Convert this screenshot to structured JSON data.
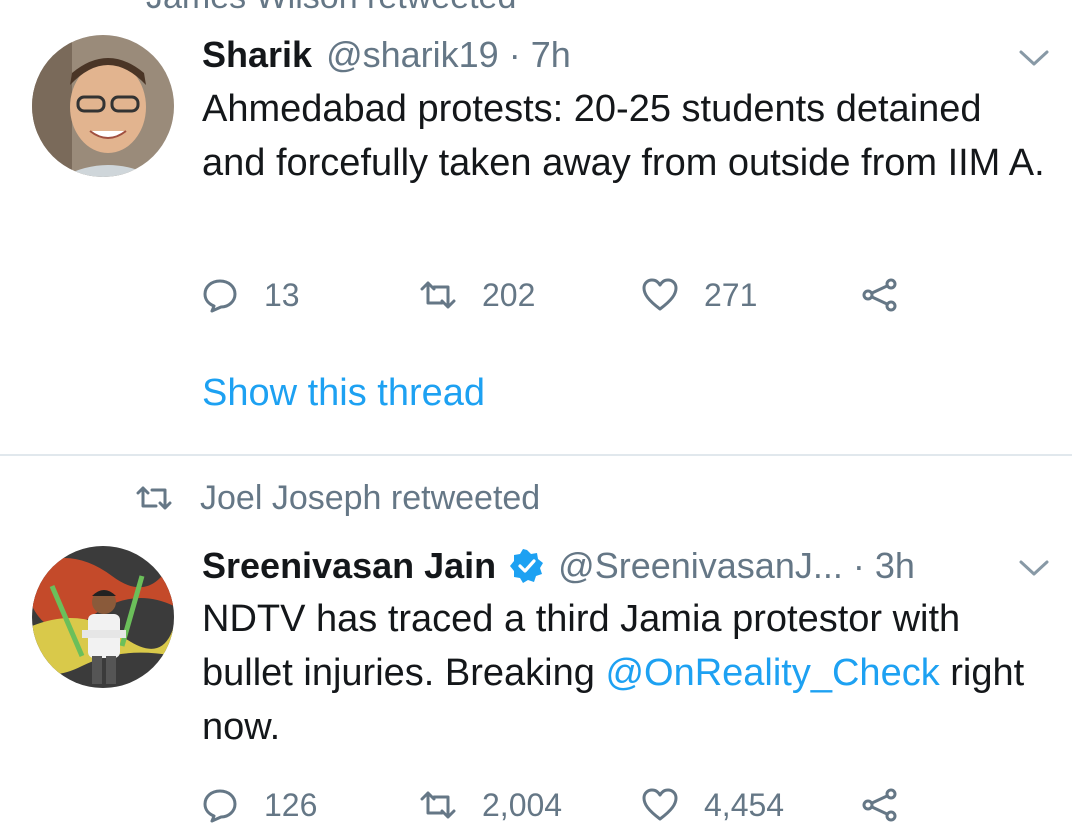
{
  "top_context": {
    "text": "James Wilson retweeted"
  },
  "tweets": [
    {
      "name": "Sharik",
      "handle": "@sharik19",
      "separator": "·",
      "time": "7h",
      "text": "Ahmedabad protests: 20-25 students detained and forcefully taken away from outside from IIM A.",
      "replies": "13",
      "retweets": "202",
      "likes": "271",
      "show_thread": "Show this thread",
      "avatar_icon": "user-avatar-sharik"
    },
    {
      "retweet_context": "Joel Joseph retweeted",
      "name": "Sreenivasan Jain",
      "verified": true,
      "handle": "@SreenivasanJ...",
      "separator": "·",
      "time": "3h",
      "text_before": "NDTV has traced a third Jamia protestor with bullet injuries. Breaking ",
      "mention": "@OnReality_Check",
      "text_after": " right now.",
      "replies": "126",
      "retweets": "2,004",
      "likes": "4,454",
      "avatar_icon": "user-avatar-sreenivasan"
    }
  ],
  "colors": {
    "text": "#14171a",
    "secondary": "#657786",
    "link": "#1da1f2",
    "divider": "#e1e8ed"
  },
  "icons": [
    "reply-icon",
    "retweet-icon",
    "like-icon",
    "share-icon",
    "chevron-down-icon",
    "verified-badge-icon"
  ]
}
